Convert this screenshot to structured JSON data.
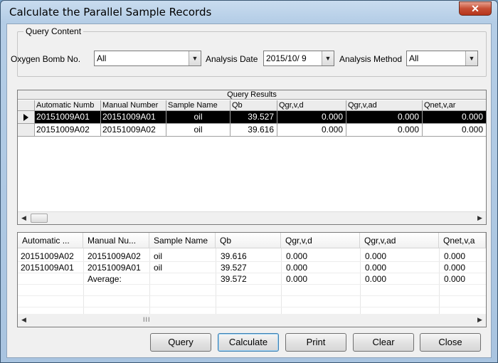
{
  "window": {
    "title": "Calculate the Parallel Sample Records",
    "close_glyph": "✕"
  },
  "query_content": {
    "legend": "Query Content",
    "oxygen_bomb": {
      "label": "Oxygen Bomb No.",
      "value": "All"
    },
    "analysis_date": {
      "label": "Analysis Date",
      "value": "2015/10/  9"
    },
    "analysis_method": {
      "label": "Analysis Method",
      "value": "All"
    }
  },
  "query_results": {
    "title": "Query Results",
    "columns": [
      "Automatic Numb",
      "Manual Number",
      "Sample Name",
      "Qb",
      "Qgr,v,d",
      "Qgr,v,ad",
      "Qnet,v,ar"
    ],
    "rows": [
      [
        "20151009A01",
        "20151009A01",
        "oil",
        "39.527",
        "0.000",
        "0.000",
        "0.000"
      ],
      [
        "20151009A02",
        "20151009A02",
        "oil",
        "39.616",
        "0.000",
        "0.000",
        "0.000"
      ]
    ],
    "selected_row": 0
  },
  "calc_list": {
    "columns": [
      "Automatic ...",
      "Manual Nu...",
      "Sample Name",
      "Qb",
      "Qgr,v,d",
      "Qgr,v,ad",
      "Qnet,v,a"
    ],
    "rows": [
      [
        "20151009A02",
        "20151009A02",
        "oil",
        "39.616",
        "0.000",
        "0.000",
        "0.000"
      ],
      [
        "20151009A01",
        "20151009A01",
        "oil",
        "39.527",
        "0.000",
        "0.000",
        "0.000"
      ],
      [
        "",
        "Average:",
        "",
        "39.572",
        "0.000",
        "0.000",
        "0.000"
      ]
    ],
    "scroll_grip": "III"
  },
  "buttons": {
    "query": "Query",
    "calculate": "Calculate",
    "print": "Print",
    "clear": "Clear",
    "close": "Close"
  },
  "icons": {
    "dropdown": "chevron-down-icon",
    "scroll_left": "arrow-left-icon",
    "scroll_right": "arrow-right-icon",
    "row_pointer": "row-pointer-icon"
  }
}
